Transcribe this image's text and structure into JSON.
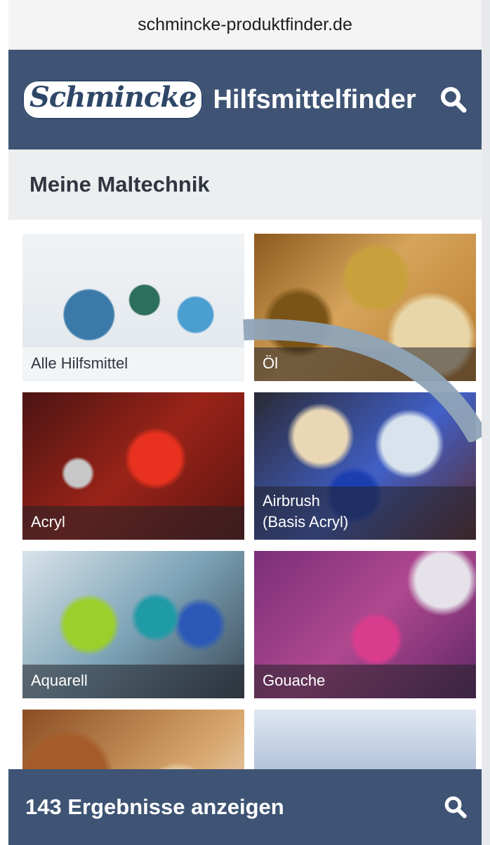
{
  "browser": {
    "url": "schmincke-produktfinder.de"
  },
  "header": {
    "logo_text": "Schmincke",
    "title": "Hilfsmittelfinder",
    "search_icon": "search-icon"
  },
  "section": {
    "title": "Meine Maltechnik"
  },
  "techniques": [
    {
      "label": "Alle Hilfsmittel"
    },
    {
      "label": "Öl"
    },
    {
      "label": "Acryl"
    },
    {
      "label": "Airbrush\n(Basis Acryl)"
    },
    {
      "label": "Aquarell"
    },
    {
      "label": "Gouache"
    }
  ],
  "footer": {
    "results_label": "143 Ergebnisse anzeigen",
    "search_icon": "search-icon"
  },
  "colors": {
    "header_bg": "#3f5474",
    "section_bg": "#edeef0",
    "accent_curve": "#8fa4b8"
  }
}
